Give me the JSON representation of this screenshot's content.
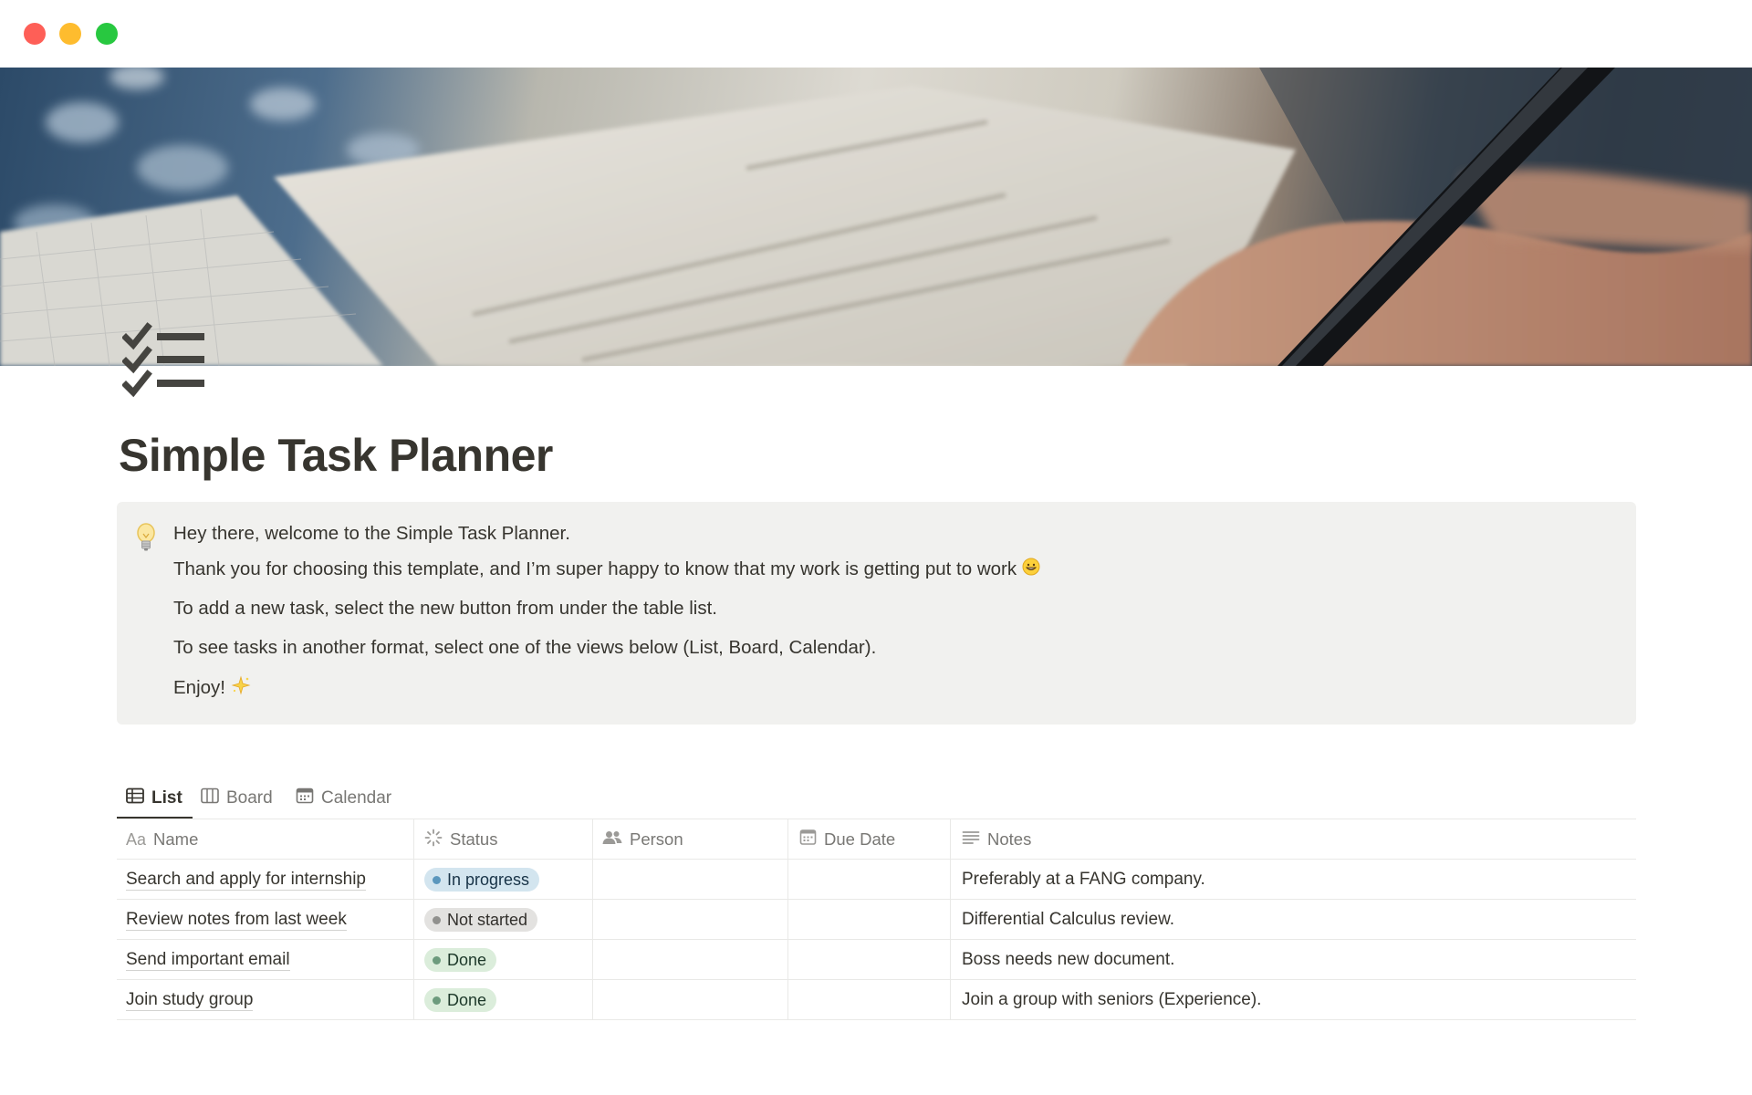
{
  "window": {
    "buttons": [
      "close",
      "minimize",
      "zoom"
    ],
    "colors": {
      "close": "#fe5f57",
      "minimize": "#febc2e",
      "zoom": "#28c840"
    }
  },
  "cover": {
    "icon": "cover-photo-writing"
  },
  "page": {
    "icon": "checklist-icon",
    "title": "Simple Task Planner"
  },
  "callout": {
    "icon": "lightbulb-icon",
    "lines": [
      "Hey there, welcome to the Simple Task Planner.",
      "Thank you for choosing this template, and I’m super happy to know that my work is getting put to work",
      "To add a new task, select the new button from under the table list.",
      "To see tasks in another format, select one of the views below (List, Board, Calendar).",
      "Enjoy!"
    ],
    "line_emojis": {
      "1": "grinning-face-icon",
      "4": "sparkle-star-icon"
    }
  },
  "views": {
    "active": "List",
    "tabs": [
      {
        "label": "List",
        "icon": "table-icon"
      },
      {
        "label": "Board",
        "icon": "board-icon"
      },
      {
        "label": "Calendar",
        "icon": "calendar-icon"
      }
    ]
  },
  "table": {
    "columns": [
      {
        "label": "Name",
        "icon_text": "Aa"
      },
      {
        "label": "Status",
        "icon": "status-icon"
      },
      {
        "label": "Person",
        "icon": "people-icon"
      },
      {
        "label": "Due Date",
        "icon": "calendar-icon"
      },
      {
        "label": "Notes",
        "icon": "text-lines-icon"
      }
    ],
    "rows": [
      {
        "name": "Search and apply for internship",
        "status": "In progress",
        "person": "",
        "due": "",
        "notes": "Preferably at a FANG company."
      },
      {
        "name": "Review notes from last week",
        "status": "Not started",
        "person": "",
        "due": "",
        "notes": "Differential Calculus review."
      },
      {
        "name": "Send important email",
        "status": "Done",
        "person": "",
        "due": "",
        "notes": "Boss needs new document."
      },
      {
        "name": "Join study group",
        "status": "Done",
        "person": "",
        "due": "",
        "notes": "Join a group with seniors (Experience)."
      }
    ]
  },
  "status_colors": {
    "In progress": {
      "bg": "#d3e5ef",
      "dot": "#5b97bd",
      "text": "#183347"
    },
    "Not started": {
      "bg": "#e3e2e0",
      "dot": "#91918e",
      "text": "#32302c"
    },
    "Done": {
      "bg": "#dbeddb",
      "dot": "#6c9b7d",
      "text": "#1c3829"
    }
  }
}
